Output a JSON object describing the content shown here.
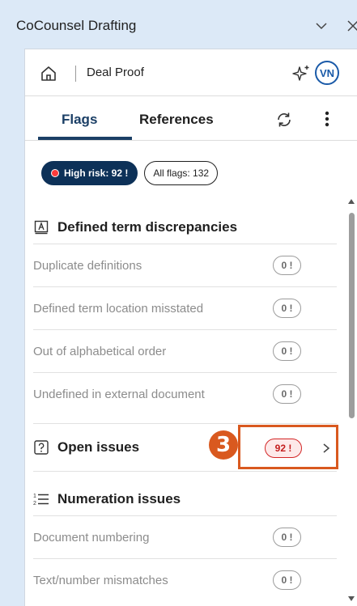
{
  "window": {
    "title": "CoCounsel Drafting"
  },
  "topbar": {
    "document_title": "Deal Proof",
    "avatar_initials": "VN"
  },
  "tabs": [
    {
      "label": "Flags",
      "active": true
    },
    {
      "label": "References",
      "active": false
    }
  ],
  "filters": {
    "high_risk_label": "High risk: 92 !",
    "all_flags_label": "All flags: 132"
  },
  "sections": {
    "defined_terms": {
      "title": "Defined term discrepancies",
      "items": [
        {
          "label": "Duplicate definitions",
          "count": "0 !"
        },
        {
          "label": "Defined term location misstated",
          "count": "0 !"
        },
        {
          "label": "Out of alphabetical order",
          "count": "0 !"
        },
        {
          "label": "Undefined in external document",
          "count": "0 !"
        }
      ]
    },
    "open_issues": {
      "title": "Open issues",
      "count": "92 !"
    },
    "numeration": {
      "title": "Numeration issues",
      "items": [
        {
          "label": "Document numbering",
          "count": "0 !"
        },
        {
          "label": "Text/number mismatches",
          "count": "0 !"
        }
      ]
    }
  },
  "annotation": {
    "step_number": "3"
  },
  "colors": {
    "accent_navy": "#0d3158",
    "annotation_orange": "#d9591f",
    "risk_red": "#d32626",
    "window_bg": "#dce9f7"
  }
}
